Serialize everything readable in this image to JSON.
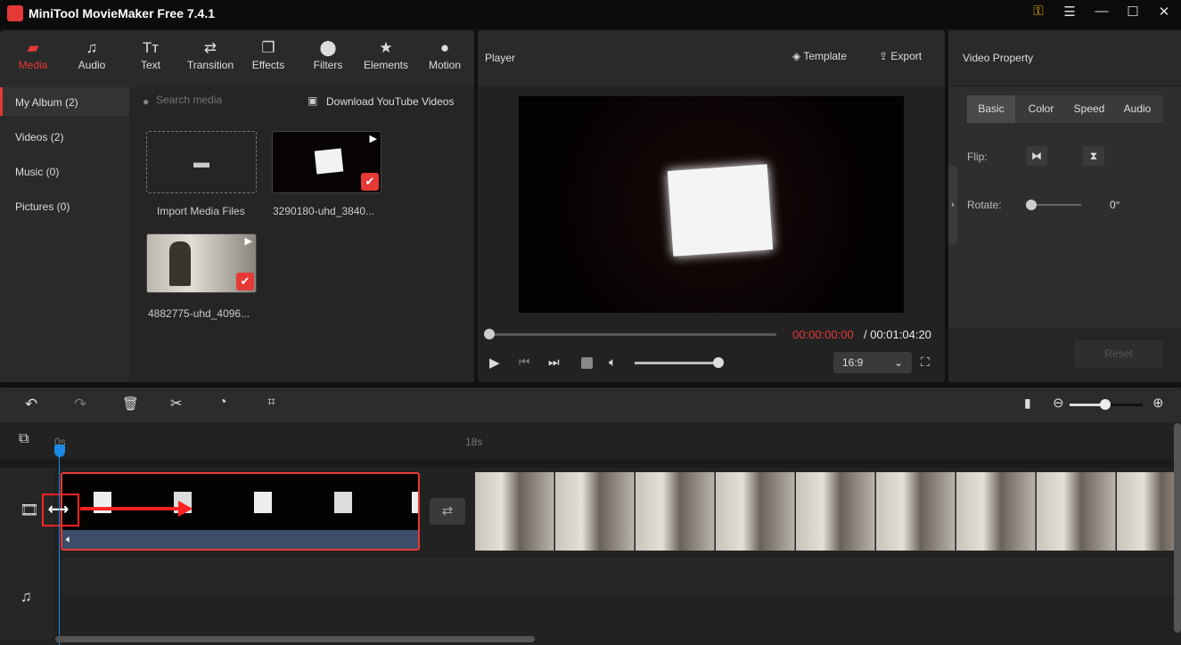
{
  "app": {
    "title": "MiniTool MovieMaker Free 7.4.1",
    "accent": "#e53935"
  },
  "window_controls": [
    "key-icon",
    "menu-icon",
    "minimize-icon",
    "maximize-icon",
    "close-icon"
  ],
  "toolbar": [
    {
      "label": "Media",
      "icon": "folder-icon",
      "active": true
    },
    {
      "label": "Audio",
      "icon": "music-icon"
    },
    {
      "label": "Text",
      "icon": "text-icon"
    },
    {
      "label": "Transition",
      "icon": "transition-icon"
    },
    {
      "label": "Effects",
      "icon": "effects-icon"
    },
    {
      "label": "Filters",
      "icon": "filters-icon"
    },
    {
      "label": "Elements",
      "icon": "elements-icon"
    },
    {
      "label": "Motion",
      "icon": "motion-icon"
    }
  ],
  "sidebar": [
    {
      "label": "My Album (2)",
      "active": true
    },
    {
      "label": "Videos (2)"
    },
    {
      "label": "Music (0)"
    },
    {
      "label": "Pictures (0)"
    }
  ],
  "media": {
    "search_placeholder": "Search media",
    "download": "Download YouTube Videos",
    "import": "Import Media Files",
    "items": [
      {
        "name": "3290180-uhd_3840...",
        "checked": true
      },
      {
        "name": "4882775-uhd_4096...",
        "checked": true
      }
    ]
  },
  "player": {
    "title": "Player",
    "template": "Template",
    "export": "Export",
    "current": "00:00:00:00",
    "total": "/ 00:01:04:20",
    "aspect": "16:9",
    "progress": 0,
    "volume": 1.0
  },
  "property": {
    "title": "Video Property",
    "tabs": [
      "Basic",
      "Color",
      "Speed",
      "Audio"
    ],
    "active_tab": "Basic",
    "flip": "Flip:",
    "rotate": "Rotate:",
    "rotate_value": "0°",
    "reset": "Reset"
  },
  "timeline": {
    "ruler": [
      "0s",
      "18s"
    ],
    "zoom": 0.5
  }
}
